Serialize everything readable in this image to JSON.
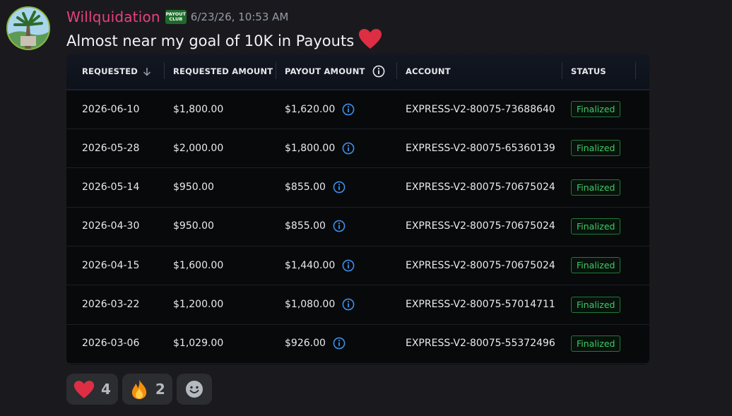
{
  "message": {
    "username": "Willquidation",
    "badge_icon": "payout-club-badge",
    "badge_text_top": "PAYOUT",
    "badge_text_bottom": "CLUB",
    "timestamp": "6/23/26, 10:53 AM",
    "text": "Almost near my goal of 10K in Payouts",
    "emoji": "red-heart"
  },
  "table": {
    "columns": [
      "REQUESTED",
      "REQUESTED AMOUNT",
      "PAYOUT AMOUNT",
      "ACCOUNT",
      "STATUS"
    ],
    "sort_icon": "arrow-down-icon",
    "rows": [
      {
        "requested": "2026-06-10",
        "requested_amount": "$1,800.00",
        "payout_amount": "$1,620.00",
        "account": "EXPRESS-V2-80075-73688640",
        "status": "Finalized"
      },
      {
        "requested": "2026-05-28",
        "requested_amount": "$2,000.00",
        "payout_amount": "$1,800.00",
        "account": "EXPRESS-V2-80075-65360139",
        "status": "Finalized"
      },
      {
        "requested": "2026-05-14",
        "requested_amount": "$950.00",
        "payout_amount": "$855.00",
        "account": "EXPRESS-V2-80075-70675024",
        "status": "Finalized"
      },
      {
        "requested": "2026-04-30",
        "requested_amount": "$950.00",
        "payout_amount": "$855.00",
        "account": "EXPRESS-V2-80075-70675024",
        "status": "Finalized"
      },
      {
        "requested": "2026-04-15",
        "requested_amount": "$1,600.00",
        "payout_amount": "$1,440.00",
        "account": "EXPRESS-V2-80075-70675024",
        "status": "Finalized"
      },
      {
        "requested": "2026-03-22",
        "requested_amount": "$1,200.00",
        "payout_amount": "$1,080.00",
        "account": "EXPRESS-V2-80075-57014711",
        "status": "Finalized"
      },
      {
        "requested": "2026-03-06",
        "requested_amount": "$1,029.00",
        "payout_amount": "$926.00",
        "account": "EXPRESS-V2-80075-55372496",
        "status": "Finalized"
      }
    ]
  },
  "reactions": [
    {
      "emoji": "heart-emoji",
      "count": "4"
    },
    {
      "emoji": "fire-emoji",
      "count": "2"
    }
  ],
  "add_reaction_icon": "smiley-add-reaction-icon",
  "colors": {
    "username": "#e8417a",
    "status_green": "#3fca68",
    "info_blue": "#3b8fe8"
  }
}
